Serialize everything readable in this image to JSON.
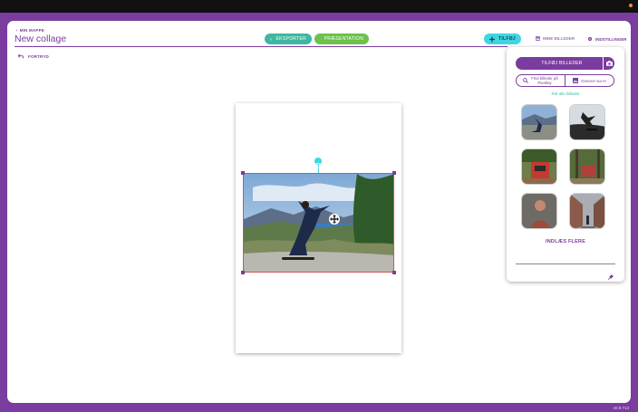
{
  "header": {
    "back_label": "MIN MAPPE",
    "title": "New collage",
    "export_label": "EKSPORTER",
    "presentation_label": "PRÆSENTATION",
    "add_label": "TILFØJ",
    "images_label": "MINE BILLEDER",
    "settings_label": "INDSTILLINGER"
  },
  "toolbar": {
    "undo_label": "FORTRYD"
  },
  "panel": {
    "add_images_label": "TILFØJ BILLEDER",
    "find_pixabay_label": "Find billeder på Pixabay",
    "generate_ai_label": "Generer via AI",
    "all_images_label": "Rút alle billeder",
    "load_more_label": "INDLÆS FLERE"
  },
  "footer": {
    "version": "v0.9.713"
  },
  "colors": {
    "brand": "#7a3c9e",
    "teal": "#3cb8a0",
    "green": "#6cc24a",
    "cyan": "#3ed7e0"
  }
}
